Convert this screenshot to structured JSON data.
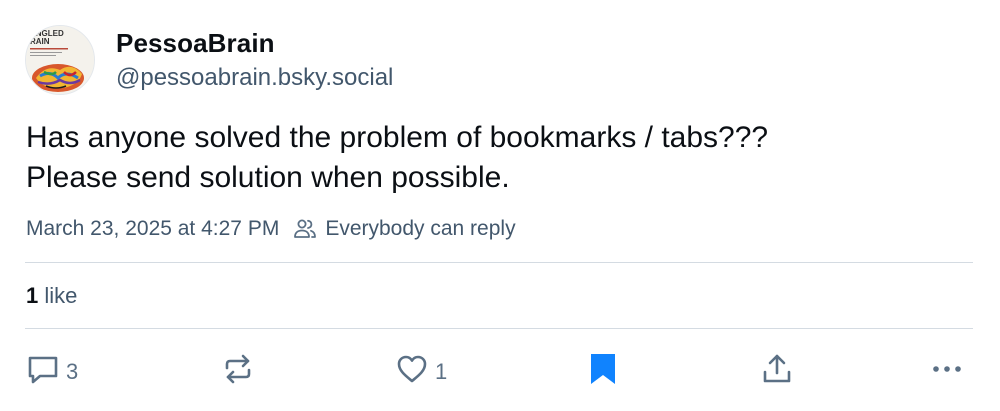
{
  "author": {
    "display_name": "PessoaBrain",
    "handle": "@pessoabrain.bsky.social",
    "avatar_text_line1": "ANGLED",
    "avatar_text_line2": "RAIN"
  },
  "post": {
    "lines": [
      "Has anyone solved the problem of bookmarks / tabs???",
      "Please send solution when possible."
    ],
    "timestamp": "March 23, 2025 at 4:27 PM",
    "reply_setting": "Everybody can reply"
  },
  "engagement": {
    "like_count": "1",
    "like_label": "like"
  },
  "actions": {
    "reply_count": "3",
    "like_count": "1",
    "bookmarked": true
  },
  "colors": {
    "text": "#0b0f14",
    "muted": "#42576c",
    "icon": "#5b7085",
    "divider": "#d4dbe2",
    "bookmark_active": "#1083fe"
  },
  "icons": [
    "reply-icon",
    "repost-icon",
    "heart-icon",
    "bookmark-icon",
    "share-icon",
    "more-icon",
    "people-icon"
  ]
}
